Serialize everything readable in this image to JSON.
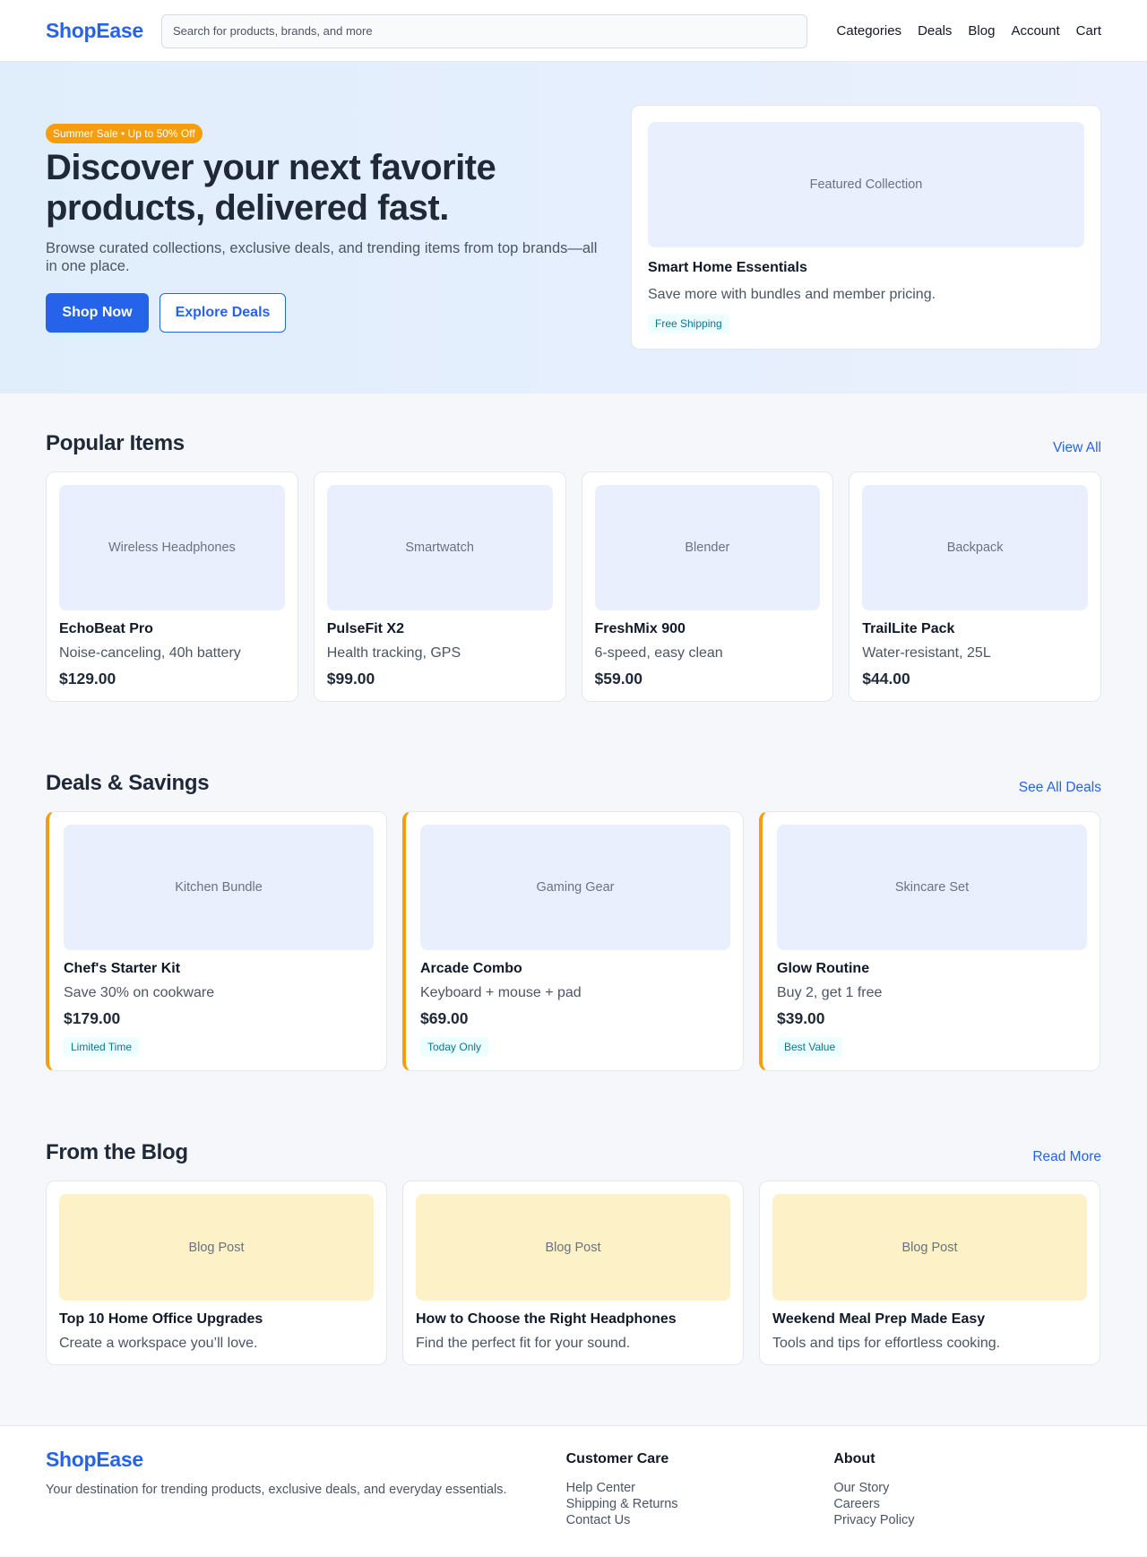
{
  "header": {
    "logo": "ShopEase",
    "search_placeholder": "Search for products, brands, and more",
    "nav": [
      "Categories",
      "Deals",
      "Blog",
      "Account",
      "Cart"
    ]
  },
  "hero": {
    "badge": "Summer Sale • Up to 50% Off",
    "title": "Discover your next favorite products, delivered fast.",
    "subtitle": "Browse curated collections, exclusive deals, and trending items from top brands—all in one place.",
    "primary_button": "Shop Now",
    "secondary_button": "Explore Deals",
    "featured": {
      "image_label": "Featured Collection",
      "title": "Smart Home Essentials",
      "subtitle": "Save more with bundles and member pricing.",
      "tag": "Free Shipping"
    }
  },
  "popular": {
    "title": "Popular Items",
    "link": "View All",
    "items": [
      {
        "image_label": "Wireless Headphones",
        "name": "EchoBeat Pro",
        "desc": "Noise-canceling, 40h battery",
        "price": "$129.00"
      },
      {
        "image_label": "Smartwatch",
        "name": "PulseFit X2",
        "desc": "Health tracking, GPS",
        "price": "$99.00"
      },
      {
        "image_label": "Blender",
        "name": "FreshMix 900",
        "desc": "6-speed, easy clean",
        "price": "$59.00"
      },
      {
        "image_label": "Backpack",
        "name": "TrailLite Pack",
        "desc": "Water-resistant, 25L",
        "price": "$44.00"
      }
    ]
  },
  "deals": {
    "title": "Deals & Savings",
    "link": "See All Deals",
    "items": [
      {
        "image_label": "Kitchen Bundle",
        "name": "Chef's Starter Kit",
        "desc": "Save 30% on cookware",
        "price": "$179.00",
        "tag": "Limited Time"
      },
      {
        "image_label": "Gaming Gear",
        "name": "Arcade Combo",
        "desc": "Keyboard + mouse + pad",
        "price": "$69.00",
        "tag": "Today Only"
      },
      {
        "image_label": "Skincare Set",
        "name": "Glow Routine",
        "desc": "Buy 2, get 1 free",
        "price": "$39.00",
        "tag": "Best Value"
      }
    ]
  },
  "blog": {
    "title": "From the Blog",
    "link": "Read More",
    "items": [
      {
        "image_label": "Blog Post",
        "title": "Top 10 Home Office Upgrades",
        "desc": "Create a workspace you’ll love."
      },
      {
        "image_label": "Blog Post",
        "title": "How to Choose the Right Headphones",
        "desc": "Find the perfect fit for your sound."
      },
      {
        "image_label": "Blog Post",
        "title": "Weekend Meal Prep Made Easy",
        "desc": "Tools and tips for effortless cooking."
      }
    ]
  },
  "footer": {
    "logo": "ShopEase",
    "tagline": "Your destination for trending products, exclusive deals, and everyday essentials.",
    "columns": [
      {
        "title": "Customer Care",
        "links": [
          "Help Center",
          "Shipping & Returns",
          "Contact Us"
        ]
      },
      {
        "title": "About",
        "links": [
          "Our Story",
          "Careers",
          "Privacy Policy"
        ]
      }
    ]
  },
  "colors": {
    "brand": "#2563eb",
    "accent": "#f59e0b",
    "tag_text": "#0e7490",
    "tag_bg": "#ecfeff"
  }
}
